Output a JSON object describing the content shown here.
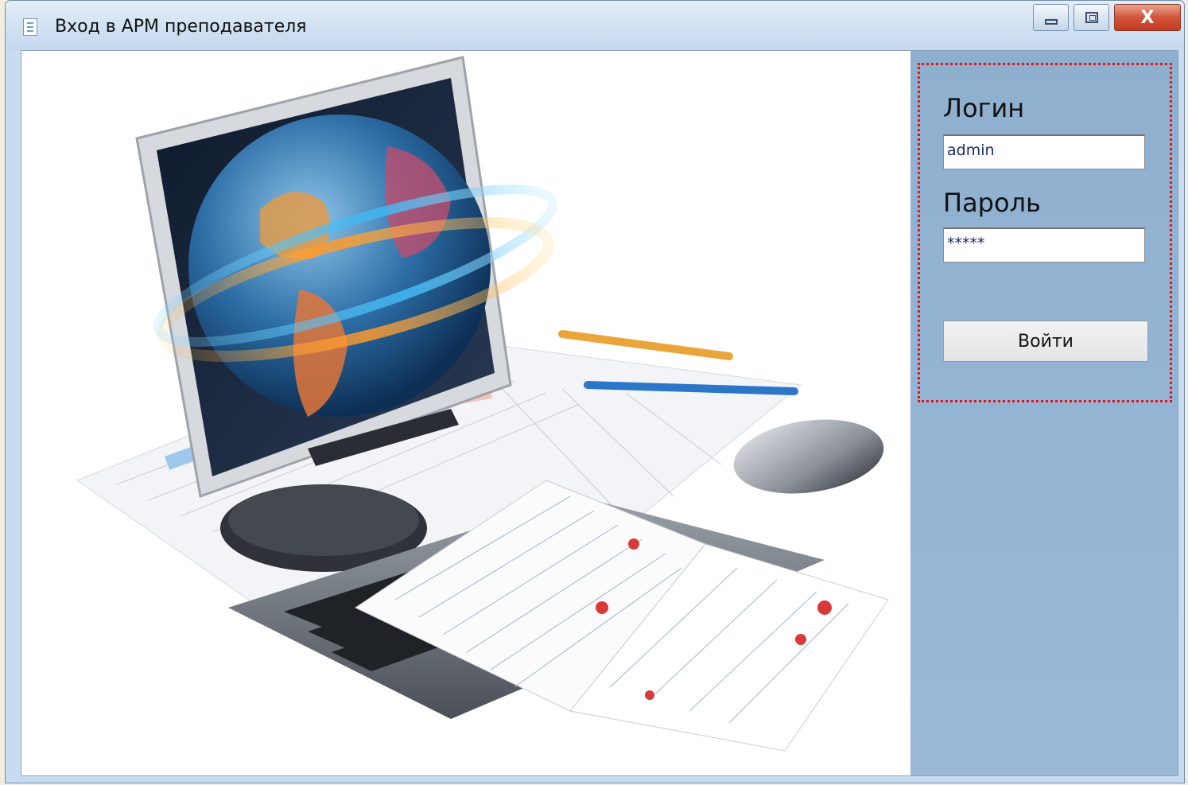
{
  "window": {
    "title": "Вход в АРМ преподавателя",
    "controls": {
      "minimize": "minimize",
      "maximize": "maximize",
      "close": "X"
    }
  },
  "login": {
    "login_label": "Логин",
    "login_value": "admin",
    "password_label": "Пароль",
    "password_value": "*****",
    "submit_label": "Войти"
  },
  "icons": [
    "app-icon",
    "minimize-icon",
    "maximize-icon",
    "close-icon"
  ],
  "colors": {
    "side_panel": "#93b3d3",
    "highlight_border": "#e3141a",
    "close_button": "#c23b22"
  }
}
